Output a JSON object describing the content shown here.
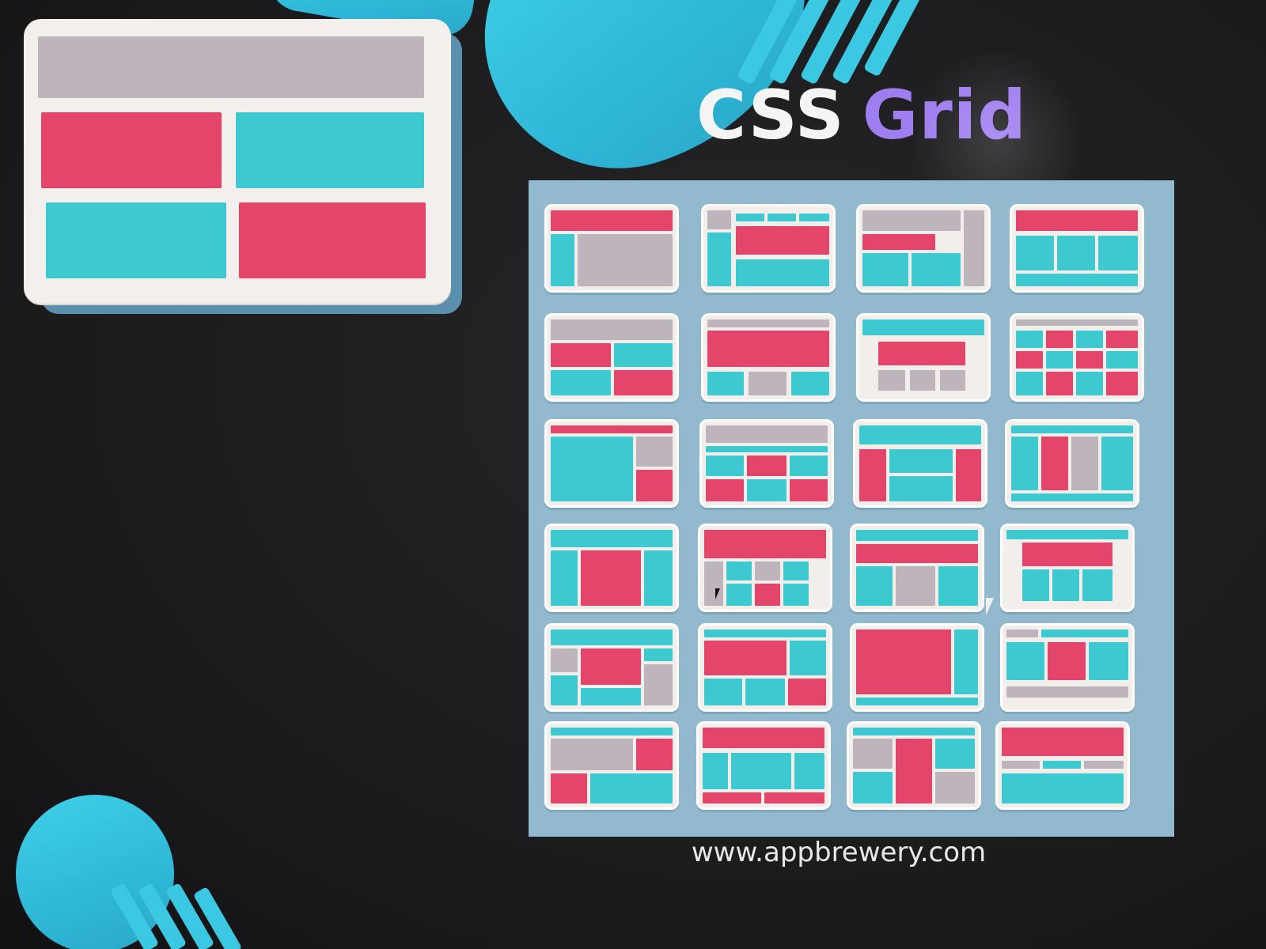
{
  "title": {
    "part1": "CSS",
    "part2": "Grid"
  },
  "footer": {
    "url": "www.appbrewery.com"
  },
  "colors": {
    "background": "#1d1d1f",
    "red": "#e4456a",
    "teal": "#3ec8cf",
    "gray": "#bdb5bb",
    "purple": "#9f7ef0",
    "panel": "#93b9cf",
    "card": "#f1eeeb"
  },
  "icons": [
    "cursor-icon"
  ]
}
